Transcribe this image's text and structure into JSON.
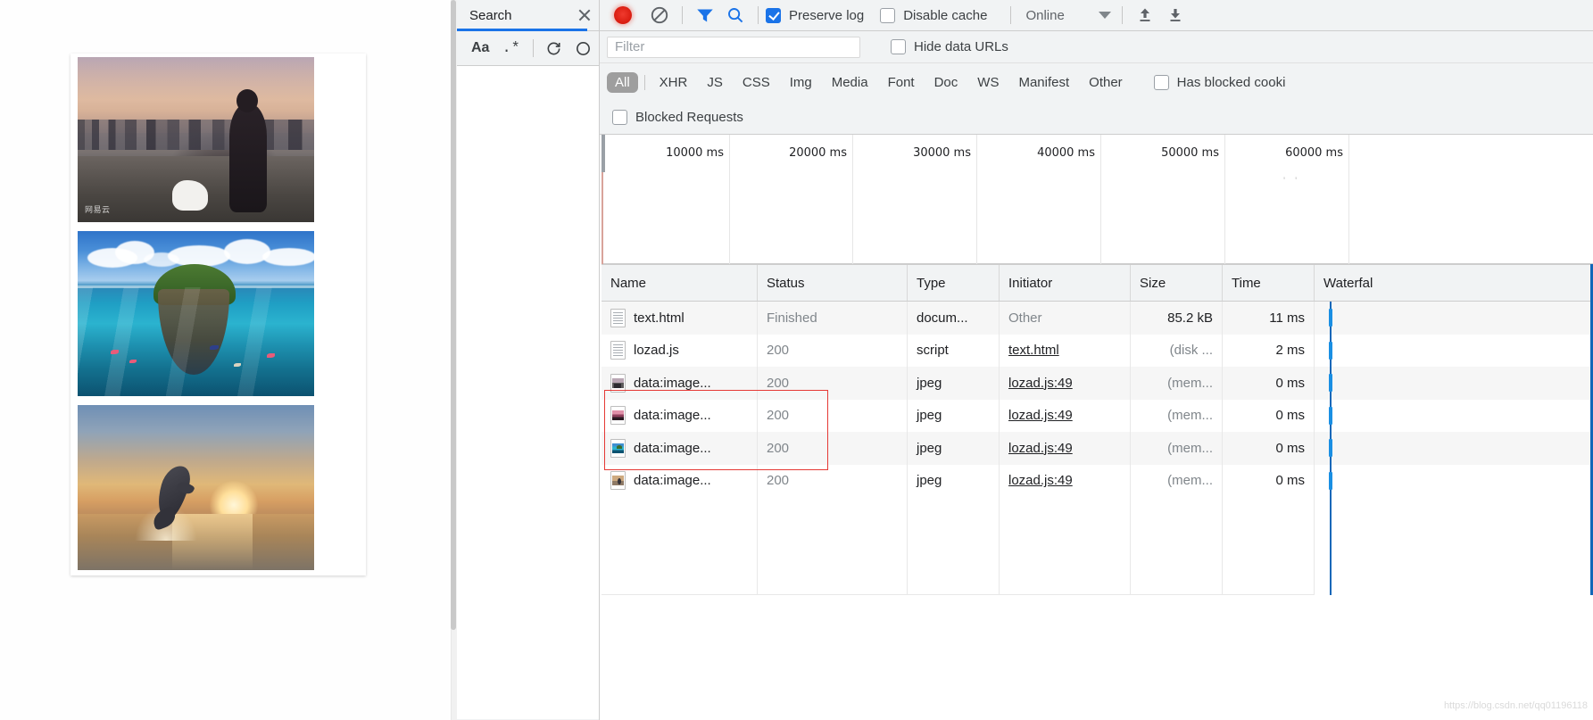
{
  "search_pane": {
    "tab_label": "Search",
    "close_icon": "close-icon",
    "toolbar": {
      "match_case_label": "Aa",
      "regex_label": ".*",
      "refresh_icon": "refresh-icon",
      "clear_icon": "clear-icon"
    }
  },
  "network_toolbar": {
    "record_icon": "record-button",
    "clear_icon": "clear-network-log-icon",
    "filter_icon": "filter-funnel-icon",
    "search_icon": "search-icon",
    "preserve_log": {
      "label": "Preserve log",
      "checked": true
    },
    "disable_cache": {
      "label": "Disable cache",
      "checked": false
    },
    "throttling": {
      "value": "Online",
      "caret_icon": "chevron-down-icon"
    },
    "import_icon": "import-har-icon",
    "export_icon": "export-har-icon"
  },
  "filter_bar": {
    "placeholder": "Filter",
    "value": "",
    "hide_data_urls": {
      "label": "Hide data URLs",
      "checked": false
    }
  },
  "type_filters": {
    "items": [
      "All",
      "XHR",
      "JS",
      "CSS",
      "Img",
      "Media",
      "Font",
      "Doc",
      "WS",
      "Manifest",
      "Other"
    ],
    "active": "All",
    "has_blocked_cookies": {
      "label": "Has blocked cooki",
      "checked": false
    },
    "blocked_requests": {
      "label": "Blocked Requests",
      "checked": false
    }
  },
  "overview": {
    "ticks": [
      "10000 ms",
      "20000 ms",
      "30000 ms",
      "40000 ms",
      "50000 ms",
      "60000 ms"
    ],
    "dots": "' '"
  },
  "table": {
    "columns": [
      "Name",
      "Status",
      "Type",
      "Initiator",
      "Size",
      "Time",
      "Waterfal"
    ],
    "rows": [
      {
        "icon": "document-file-icon",
        "name": "text.html",
        "status": "Finished",
        "status_dim": true,
        "type": "docum...",
        "initiator": "Other",
        "initiator_link": false,
        "size": "85.2 kB",
        "size_dim": false,
        "time": "11 ms"
      },
      {
        "icon": "script-file-icon",
        "name": "lozad.js",
        "status": "200",
        "status_dim": true,
        "type": "script",
        "initiator": "text.html",
        "initiator_link": true,
        "size": "(disk ...",
        "size_dim": true,
        "time": "2 ms"
      },
      {
        "icon": "image-thumbnail-city-icon",
        "name": "data:image...",
        "status": "200",
        "status_dim": true,
        "type": "jpeg",
        "initiator": "lozad.js:49",
        "initiator_link": true,
        "size": "(mem...",
        "size_dim": true,
        "time": "0 ms"
      },
      {
        "icon": "image-thumbnail-sunset-icon",
        "name": "data:image...",
        "status": "200",
        "status_dim": true,
        "type": "jpeg",
        "initiator": "lozad.js:49",
        "initiator_link": true,
        "size": "(mem...",
        "size_dim": true,
        "time": "0 ms"
      },
      {
        "icon": "image-thumbnail-island-icon",
        "name": "data:image...",
        "status": "200",
        "status_dim": true,
        "type": "jpeg",
        "initiator": "lozad.js:49",
        "initiator_link": true,
        "size": "(mem...",
        "size_dim": true,
        "time": "0 ms"
      },
      {
        "icon": "image-thumbnail-dolphin-icon",
        "name": "data:image...",
        "status": "200",
        "status_dim": true,
        "type": "jpeg",
        "initiator": "lozad.js:49",
        "initiator_link": true,
        "size": "(mem...",
        "size_dim": true,
        "time": "0 ms"
      }
    ]
  },
  "annotation": {
    "highlight_note": "red-rectangle-around-last-two-image-rows"
  },
  "watermark": {
    "text": "https://blog.csdn.net/qq01196118"
  },
  "page_preview": {
    "images": [
      {
        "name": "city-dusk-photo",
        "watermark": "网易云"
      },
      {
        "name": "island-underwater-photo"
      },
      {
        "name": "dolphin-sunset-photo"
      }
    ]
  },
  "colors": {
    "accent_blue": "#1a73e8",
    "waterfall_blue": "#1267b8",
    "record_red": "#d81b0f",
    "annotation_red": "#e53935",
    "toolbar_bg": "#f1f3f4",
    "active_pill": "#9e9e9e"
  }
}
